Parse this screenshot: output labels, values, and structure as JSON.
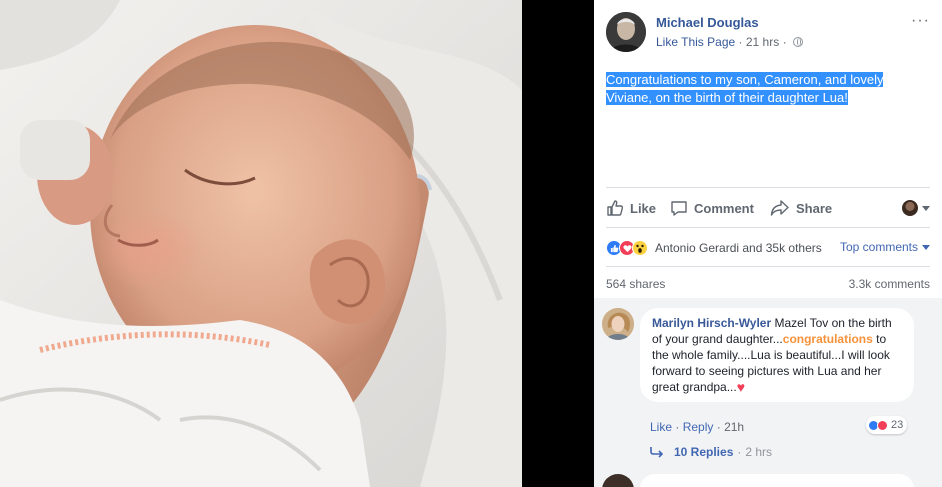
{
  "post": {
    "author": "Michael Douglas",
    "like_page": "Like This Page",
    "time": "21 hrs",
    "separator": "·",
    "more_label": "···",
    "text": "Congratulations to my son, Cameron, and lovely Viviane, on the birth of their daughter Lua!"
  },
  "actions": {
    "like": "Like",
    "comment": "Comment",
    "share": "Share"
  },
  "reactions": {
    "names": "Antonio Gerardi and 35k others",
    "top_comments": "Top comments",
    "icons": [
      "like-icon",
      "love-icon",
      "wow-icon"
    ]
  },
  "counts": {
    "shares": "564 shares",
    "comments": "3.3k comments"
  },
  "comment": {
    "name": "Marilyn Hirsch-Wyler",
    "text_before": " Mazel Tov on the birth of your grand daughter...",
    "highlight": "congratulations",
    "text_after": " to the whole family....Lua is beautiful...I will look forward to seeing pictures with Lua and her great grandpa...",
    "heart": "♥",
    "reaction_count": "23",
    "like": "Like",
    "reply": "Reply",
    "time": "21h",
    "dot": "·",
    "replies": "10 Replies",
    "replies_time": "2 hrs"
  },
  "colors": {
    "link_blue": "#365899",
    "highlight_bg": "#3390ff",
    "keyword_orange": "#f7923a",
    "like_blue": "#2e7bf6",
    "love_red": "#f33e58"
  }
}
